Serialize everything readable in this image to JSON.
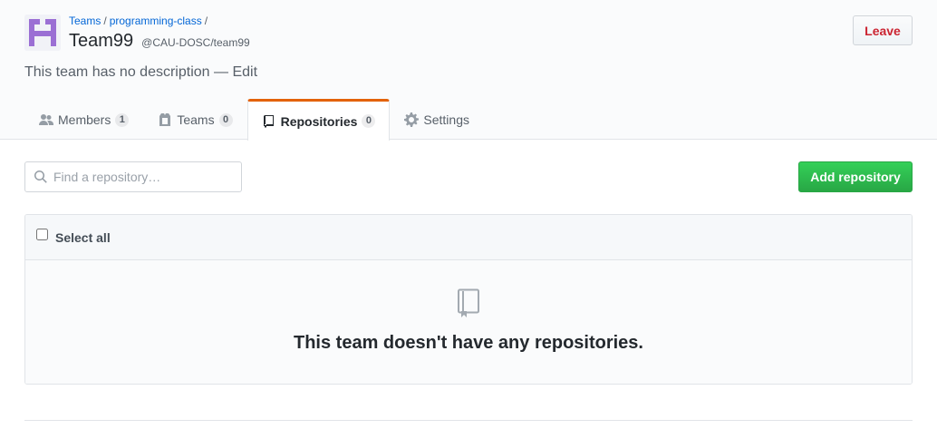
{
  "breadcrumb": {
    "items": [
      "Teams",
      "programming-class"
    ],
    "separator": "/"
  },
  "team": {
    "name": "Team99",
    "handle": "@CAU-DOSC/team99",
    "description": "This team has no description — Edit",
    "avatar_color": "#9b6fd4"
  },
  "leave_label": "Leave",
  "tabs": [
    {
      "label": "Members",
      "count": "1",
      "icon": "person-icon"
    },
    {
      "label": "Teams",
      "count": "0",
      "icon": "jersey-icon"
    },
    {
      "label": "Repositories",
      "count": "0",
      "icon": "repo-icon",
      "selected": true
    },
    {
      "label": "Settings",
      "icon": "gear-icon"
    }
  ],
  "search": {
    "placeholder": "Find a repository…",
    "value": ""
  },
  "add_repository_label": "Add repository",
  "list": {
    "select_all_label": "Select all",
    "empty_message": "This team doesn't have any repositories."
  },
  "colors": {
    "accent_tab": "#e36209",
    "leave_text": "#cb2431",
    "add_button": "#28a745",
    "link": "#0366d6"
  }
}
